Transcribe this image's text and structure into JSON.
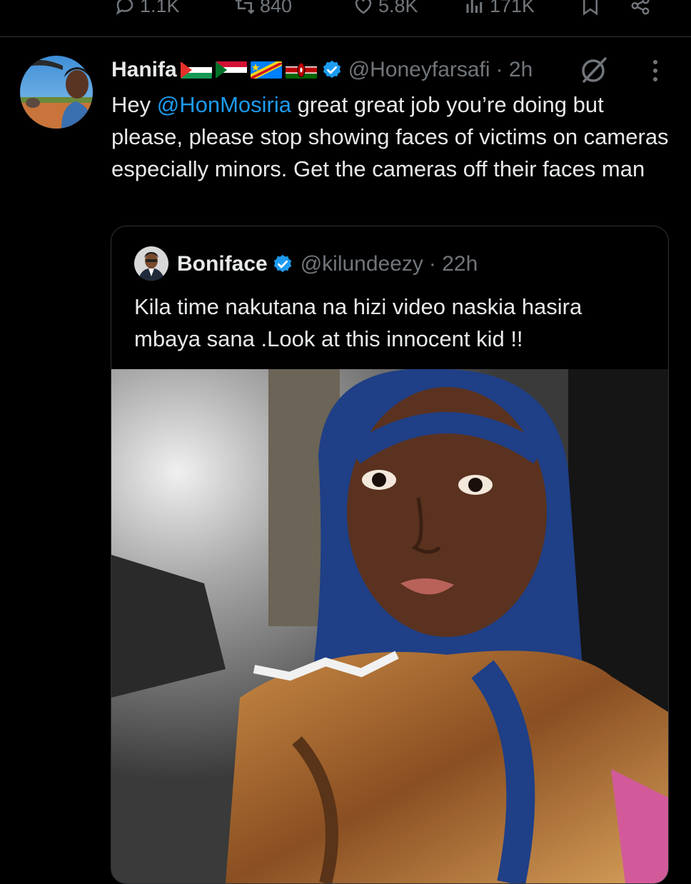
{
  "action_bar": {
    "replies": "1.1K",
    "reposts": "840",
    "likes": "5.8K",
    "views": "171K"
  },
  "tweet": {
    "display_name": "Hanifa",
    "handle": "@Honeyfarsafi",
    "time": "· 2h",
    "text_before": "Hey ",
    "mention": "@HonMosiria",
    "text_after": " great great job you’re doing but please, please stop showing faces of victims on cameras especially minors. Get the cameras off their faces man"
  },
  "quoted_tweet": {
    "display_name": "Boniface",
    "handle": "@kilundeezy",
    "time": "· 22h",
    "text": "Kila time nakutana na hizi video naskia hasira mbaya sana .Look at this innocent kid !!"
  },
  "colors": {
    "background": "#000000",
    "text": "#e7e9ea",
    "muted": "#71767b",
    "accent": "#1d9bf0",
    "border": "#2f3336"
  },
  "icons": [
    "reply-icon",
    "repost-icon",
    "like-icon",
    "views-icon",
    "bookmark-icon",
    "share-icon",
    "verified-badge-icon",
    "grok-icon",
    "more-icon"
  ]
}
